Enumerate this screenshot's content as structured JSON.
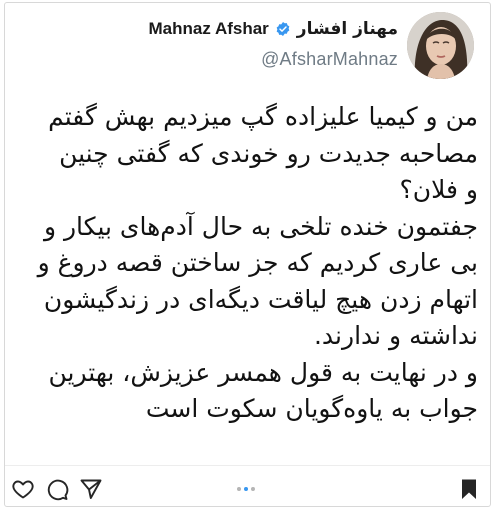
{
  "post": {
    "author": {
      "display_name_fa": "مهناز افشار",
      "display_name_en": "Mahnaz Afshar",
      "handle": "@AfsharMahnaz",
      "verified": true
    },
    "text_lines": [
      "من و کیمیا علیزاده گپ میزدیم بهش گفتم",
      "مصاحبه جدیدت رو خوندی که گفتی چنین",
      "و فلان؟",
      "جفتمون خنده تلخی به حال آدم‌های بیکار و",
      "بی عاری کردیم که جز ساختن قصه دروغ و",
      "اتهام زدن هیچ لیاقت دیگه‌ای در زندگیشون",
      "نداشته و ندارند.",
      "و در نهایت به قول همسر عزیزش، بهترین",
      "جواب به یاوه‌گویان سکوت است"
    ]
  },
  "toolbar": {
    "icons": [
      "heart-icon",
      "comment-icon",
      "share-icon",
      "bookmark-icon"
    ],
    "carousel": {
      "count": 3,
      "active_index": 1
    }
  },
  "colors": {
    "verified_badge": "#3897f0",
    "handle_text": "#6f7b85",
    "body_text": "#121212",
    "carousel_active": "#3897f0"
  }
}
